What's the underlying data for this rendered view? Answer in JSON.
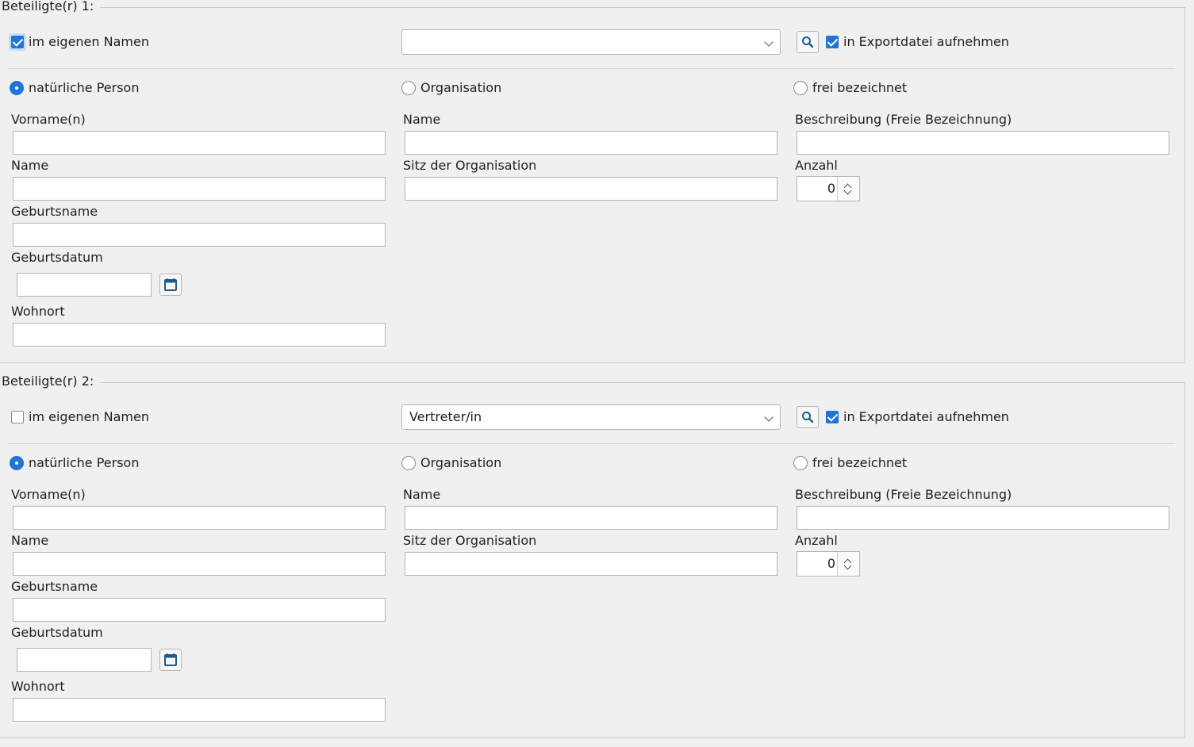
{
  "groups": [
    {
      "title": "Beteiligte(r) 1:",
      "own_name": {
        "label": "im eigenen Namen",
        "checked": true
      },
      "role_select": {
        "value": ""
      },
      "export": {
        "label": "in Exportdatei aufnehmen",
        "checked": true
      },
      "types": {
        "natural": {
          "label": "natürliche Person",
          "selected": true
        },
        "organisation": {
          "label": "Organisation",
          "selected": false
        },
        "free": {
          "label": "frei bezeichnet",
          "selected": false
        }
      },
      "natural_fields": {
        "first_names": "Vorname(n)",
        "name": "Name",
        "birth_name": "Geburtsname",
        "birth_date": "Geburtsdatum",
        "residence": "Wohnort"
      },
      "org_fields": {
        "name": "Name",
        "seat": "Sitz der Organisation"
      },
      "free_fields": {
        "description": "Beschreibung (Freie Bezeichnung)",
        "count_label": "Anzahl",
        "count_value": "0"
      }
    },
    {
      "title": "Beteiligte(r) 2:",
      "own_name": {
        "label": "im eigenen Namen",
        "checked": false
      },
      "role_select": {
        "value": "Vertreter/in"
      },
      "export": {
        "label": "in Exportdatei aufnehmen",
        "checked": true
      },
      "types": {
        "natural": {
          "label": "natürliche Person",
          "selected": true
        },
        "organisation": {
          "label": "Organisation",
          "selected": false
        },
        "free": {
          "label": "frei bezeichnet",
          "selected": false
        }
      },
      "natural_fields": {
        "first_names": "Vorname(n)",
        "name": "Name",
        "birth_name": "Geburtsname",
        "birth_date": "Geburtsdatum",
        "residence": "Wohnort"
      },
      "org_fields": {
        "name": "Name",
        "seat": "Sitz der Organisation"
      },
      "free_fields": {
        "description": "Beschreibung (Freie Bezeichnung)",
        "count_label": "Anzahl",
        "count_value": "0"
      }
    }
  ],
  "colors": {
    "accent": "#1f74d6",
    "background": "#f0f0f0",
    "icon": "#1f5a8c"
  },
  "icons": {
    "search": "search-icon",
    "calendar": "calendar-icon"
  }
}
